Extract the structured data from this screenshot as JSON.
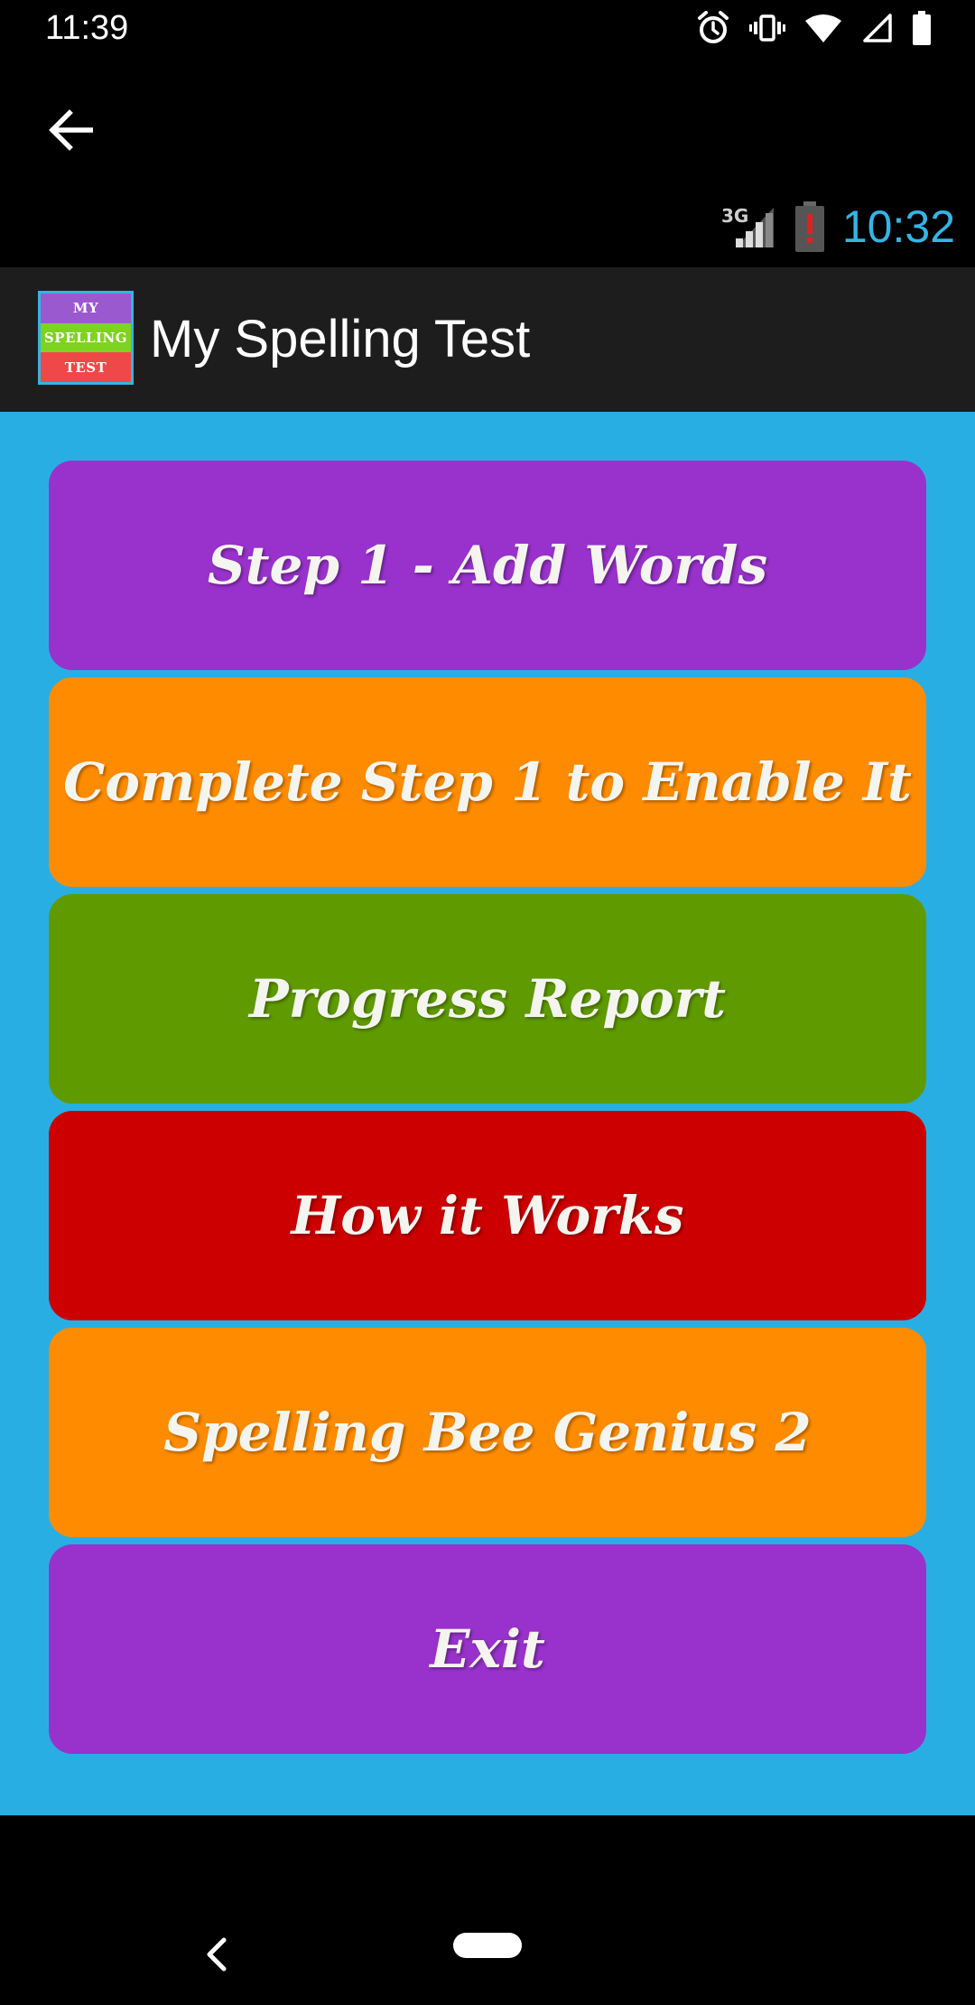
{
  "status_bar": {
    "time": "11:39",
    "icons": [
      "alarm-icon",
      "vibrate-icon",
      "wifi-icon",
      "signal-icon",
      "battery-icon"
    ]
  },
  "inner_status": {
    "network": "3G",
    "time": "10:32"
  },
  "app_bar": {
    "title": "My Spelling Test",
    "logo_lines": [
      "MY",
      "SPELLING",
      "TEST"
    ]
  },
  "menu": [
    {
      "label": "Step 1 - Add Words",
      "color": "#9932cc"
    },
    {
      "label": "Complete Step 1 to Enable It",
      "color": "#ff8c00"
    },
    {
      "label": "Progress Report",
      "color": "#5f9b00"
    },
    {
      "label": "How it Works",
      "color": "#cc0000"
    },
    {
      "label": "Spelling Bee Genius 2",
      "color": "#ff8c00"
    },
    {
      "label": "Exit",
      "color": "#9932cc"
    }
  ]
}
